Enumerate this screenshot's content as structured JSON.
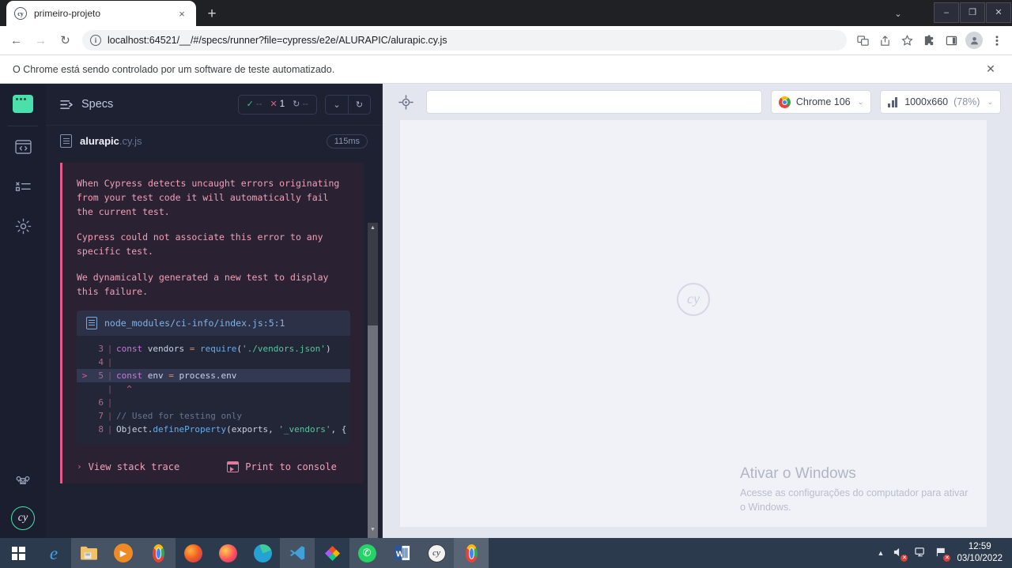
{
  "browser": {
    "tab": {
      "title": "primeiro-projeto",
      "favicon": "cypress-icon",
      "close": "×"
    },
    "new_tab": "+",
    "window_controls": {
      "minimize": "–",
      "maximize": "❐",
      "close": "✕",
      "tab_search": "⌄"
    },
    "nav": {
      "back": "←",
      "forward": "→",
      "reload": "↻"
    },
    "omnibox": {
      "info_glyph": "i",
      "url": "localhost:64521/__/#/specs/runner?file=cypress/e2e/ALURAPIC/alurapic.cy.js"
    },
    "toolbar_icons": [
      "translate-icon",
      "share-icon",
      "bookmark-star-icon",
      "extensions-icon",
      "side-panel-icon",
      "profile-avatar",
      "chrome-menu-icon"
    ],
    "infobar": {
      "text": "O Chrome está sendo controlado por um software de teste automatizado.",
      "close": "✕"
    }
  },
  "cypress": {
    "rail": {
      "project_icon": "project-window-icon",
      "items": [
        "specs-code-icon",
        "runs-list-icon",
        "settings-gear-icon"
      ],
      "shortcuts_icon": "keyboard-shortcut-icon",
      "logo": "cy"
    },
    "specs_panel": {
      "title": "Specs",
      "title_icon": "specs-list-icon",
      "stats": [
        {
          "name": "passed",
          "glyph": "✓",
          "value": "--",
          "color": "#36c48e"
        },
        {
          "name": "failed",
          "glyph": "✕",
          "value": "1",
          "color": "#e45c88"
        },
        {
          "name": "pending",
          "glyph": "↻",
          "value": "--",
          "color": "#9aa2bb"
        }
      ],
      "expand_button": "⌄",
      "rerun_button": "↻",
      "spec": {
        "name": "alurapic",
        "ext": ".cy.js",
        "duration": "115ms"
      }
    },
    "error": {
      "paragraphs": [
        "When Cypress detects uncaught errors originating from your test code it will automatically fail the current test.",
        "Cypress could not associate this error to any specific test.",
        "We dynamically generated a new test to display this failure."
      ],
      "code_file": "node_modules/ci-info/index.js:5:1",
      "code_lines": [
        {
          "arrow": "",
          "no": "3",
          "bar": "|",
          "code": "const vendors = require('./vendors.json')",
          "highlight": false
        },
        {
          "arrow": "",
          "no": "4",
          "bar": "|",
          "code": "",
          "highlight": false
        },
        {
          "arrow": ">",
          "no": "5",
          "bar": "|",
          "code": "const env = process.env",
          "highlight": true
        },
        {
          "arrow": "",
          "no": "",
          "bar": "|",
          "code": "  ^",
          "highlight": false
        },
        {
          "arrow": "",
          "no": "6",
          "bar": "|",
          "code": "",
          "highlight": false
        },
        {
          "arrow": "",
          "no": "7",
          "bar": "|",
          "code": "// Used for testing only",
          "highlight": false
        },
        {
          "arrow": "",
          "no": "8",
          "bar": "|",
          "code": "Object.defineProperty(exports, '_vendors', {",
          "highlight": false
        }
      ],
      "actions": {
        "stack_trace": "View stack trace",
        "stack_trace_chevron": "›",
        "print_console": "Print to console",
        "print_console_icon": "console-window-icon"
      }
    },
    "preview": {
      "selector_icon": "selector-playground-icon",
      "url_value": "",
      "browser_pill": {
        "label": "Chrome 106",
        "icon": "chrome-logo-icon",
        "caret": "⌄"
      },
      "viewport_pill": {
        "size": "1000x660",
        "scale": "(78%)",
        "icon": "viewport-bars-icon",
        "caret": "⌄"
      },
      "aut_logo": "cy"
    }
  },
  "windows_watermark": {
    "title": "Ativar o Windows",
    "subtitle": "Acesse as configurações do computador para ativar o Windows."
  },
  "taskbar": {
    "start_icon": "windows-start-icon",
    "apps": [
      {
        "name": "internet-explorer-icon",
        "glyph": "℮",
        "color": "#41a5e8",
        "state": ""
      },
      {
        "name": "file-explorer-icon",
        "glyph": "🗂",
        "color": "#f0c36a",
        "state": "open"
      },
      {
        "name": "media-player-icon",
        "glyph": "▶",
        "color": "#f08a24",
        "state": "open"
      },
      {
        "name": "chrome-icon",
        "glyph": "●",
        "color": "#4285f4",
        "state": "open"
      },
      {
        "name": "firefox-icon",
        "glyph": "●",
        "color": "#e66000",
        "state": ""
      },
      {
        "name": "firefox-dev-icon",
        "glyph": "●",
        "color": "#ff4f5e",
        "state": ""
      },
      {
        "name": "edge-icon",
        "glyph": "●",
        "color": "#25a2d4",
        "state": ""
      },
      {
        "name": "vscode-icon",
        "glyph": "✕",
        "color": "#3fa0da",
        "state": "open"
      },
      {
        "name": "figma-icon",
        "glyph": "◆",
        "color": "#f24e1e",
        "state": ""
      },
      {
        "name": "whatsapp-icon",
        "glyph": "✆",
        "color": "#25d366",
        "state": "open"
      },
      {
        "name": "word-icon",
        "glyph": "W",
        "color": "#2b579a",
        "state": "open"
      },
      {
        "name": "cypress-icon",
        "glyph": "cy",
        "color": "#2b2b2b",
        "state": "open"
      },
      {
        "name": "chrome-active-icon",
        "glyph": "●",
        "color": "#4285f4",
        "state": "active"
      }
    ],
    "tray": {
      "caret": "▲",
      "volume_icon": "volume-muted-icon",
      "network_icon": "network-icon",
      "flag_icon": "action-center-flag-icon",
      "time": "12:59",
      "date": "03/10/2022"
    }
  }
}
